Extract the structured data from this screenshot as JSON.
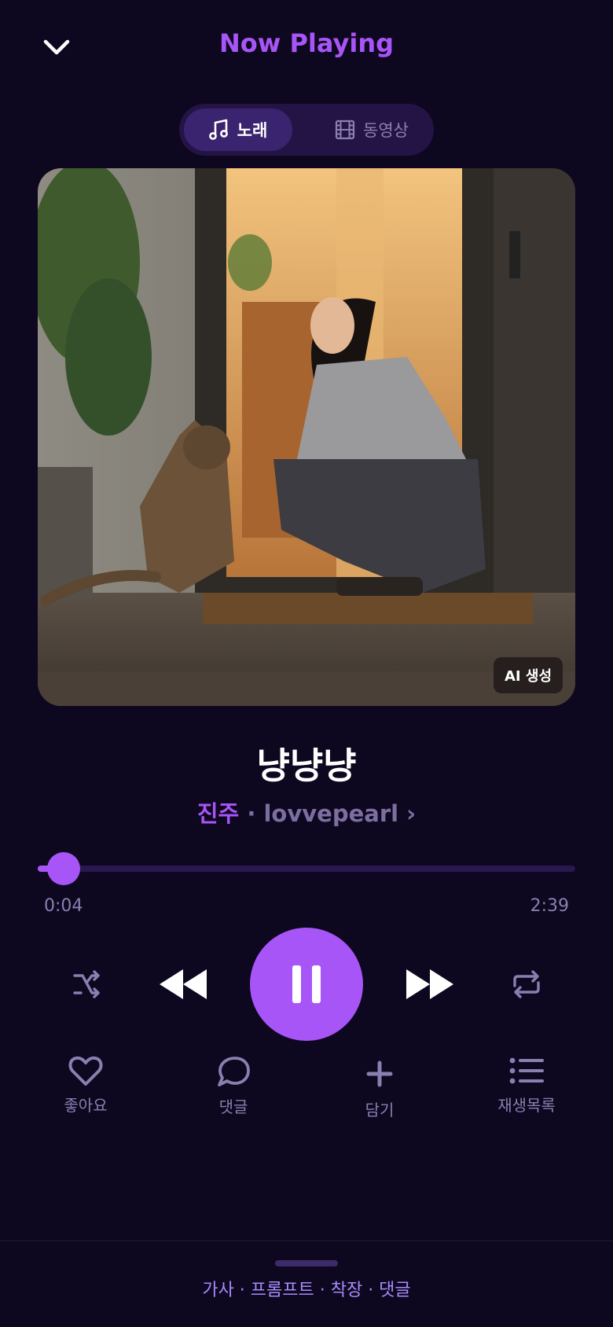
{
  "header": {
    "title": "Now Playing",
    "collapse_icon": "chevron-down-icon"
  },
  "tabs": [
    {
      "label": "노래",
      "icon": "music-note-icon",
      "selected": true
    },
    {
      "label": "동영상",
      "icon": "film-icon",
      "selected": false
    }
  ],
  "artwork": {
    "badge": "AI 생성"
  },
  "song": {
    "title": "냥냥냥",
    "artist": "진주",
    "separator": "·",
    "handle": "lovvepearl ›"
  },
  "progress": {
    "elapsed": "0:04",
    "total": "2:39",
    "fraction": 0.025
  },
  "controls": [
    "shuffle-icon",
    "rewind-icon",
    "pause-icon",
    "fast-forward-icon",
    "repeat-icon"
  ],
  "actions": [
    {
      "label": "좋아요",
      "icon": "heart-icon"
    },
    {
      "label": "댓글",
      "icon": "comment-icon"
    },
    {
      "label": "담기",
      "icon": "plus-icon"
    },
    {
      "label": "재생목록",
      "icon": "list-icon"
    }
  ],
  "bottom_sheet": {
    "links": "가사 · 프롬프트 · 착장 · 댓글"
  },
  "colors": {
    "background": "#0e0720",
    "accent": "#a855f7",
    "muted": "#8b7fb0",
    "link": "#a78bfa"
  }
}
